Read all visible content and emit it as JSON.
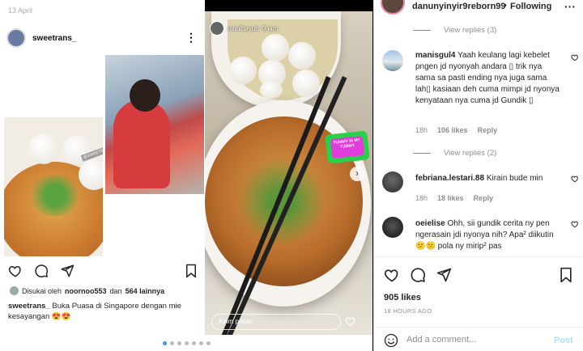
{
  "left_post": {
    "date": "13 April",
    "username": "sweetrans_",
    "liked_prefix": "Disukai oleh",
    "liked_user": "noornoo553",
    "liked_and": "dan",
    "liked_count": "564 lainnya",
    "caption_user": "sweetrans_",
    "caption_text": "Buka Puasa di Singapore dengan mie kesayangan 😍😍",
    "watermark": "@SWEETRANS"
  },
  "story": {
    "username": "mimibayuh",
    "time": "9 jam",
    "reply_placeholder": "Kirim pesan",
    "sticker": "YUMMY IN MY TUMMY"
  },
  "panel": {
    "username": "danunyinyir9reborn99",
    "dot": "•",
    "follow_label": "Following",
    "more": "···",
    "view_replies_1": "View replies (3)",
    "view_replies_2": "View replies (2)",
    "comments": [
      {
        "user": "manisgul4",
        "text": "Yaah keulang lagi kebelet pngen jd nyonyah andara ▯ trik nya sama sa pasti ending nya juga sama lah▯ kasiaan deh cuma mimpi jd nyonya kenyataan nya cuma jd Gundik ▯",
        "age": "18h",
        "likes": "106 likes",
        "reply": "Reply"
      },
      {
        "user": "febriana.lestari.88",
        "text": "Kirain bude min",
        "age": "18h",
        "likes": "18 likes",
        "reply": "Reply"
      },
      {
        "user": "oeielise",
        "text": "Ohh, sii gundik cerita ny pen ngerasain jdi nyonya nih? Apa² diikutin 😕😕 pola ny mirip² pas",
        "age": "",
        "likes": "",
        "reply": ""
      }
    ],
    "likes_count": "905 likes",
    "time_ago": "18 HOURS AGO",
    "add_comment_placeholder": "Add a comment...",
    "post_label": "Post"
  },
  "carousel": {
    "count": 7,
    "active_index": 0
  },
  "colors": {
    "accent": "#3897f0",
    "post_disabled": "#b2dffc",
    "muted": "#8e8e8e"
  }
}
